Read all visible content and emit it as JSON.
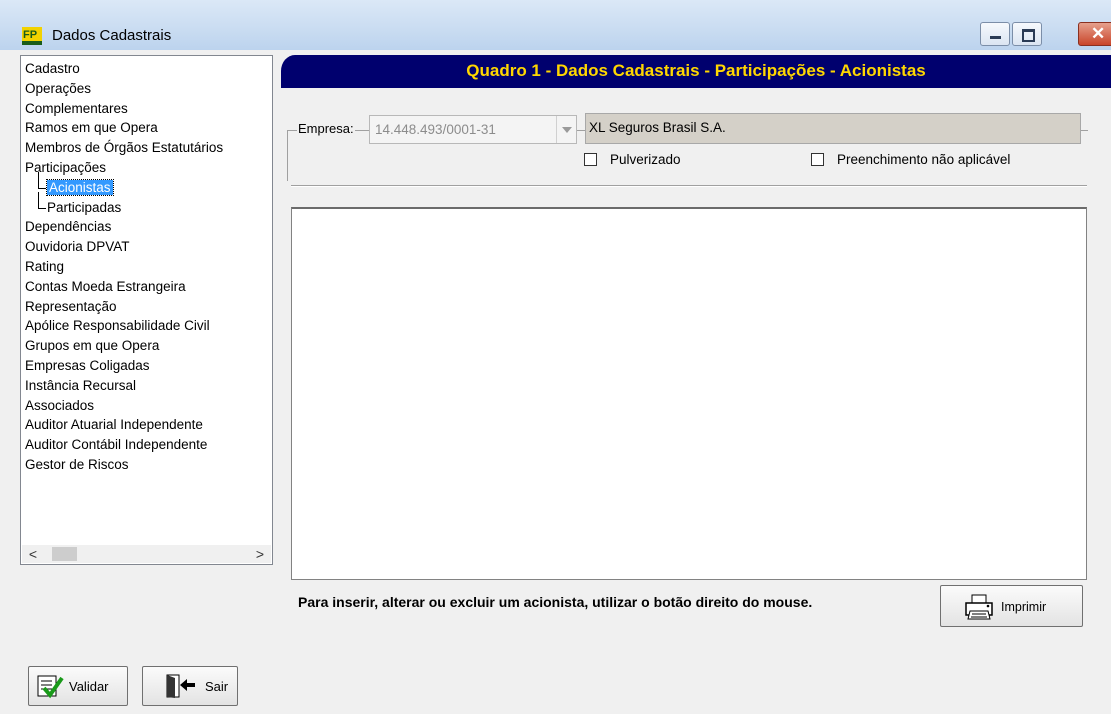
{
  "window": {
    "title": "Dados Cadastrais",
    "app_icon": "fip-logo-icon",
    "controls": [
      "minimize-icon",
      "maximize-icon",
      "close-icon"
    ]
  },
  "tree": {
    "items": [
      {
        "label": "Cadastro",
        "level": 0
      },
      {
        "label": "Operações",
        "level": 0
      },
      {
        "label": "Complementares",
        "level": 0
      },
      {
        "label": "Ramos em que Opera",
        "level": 0
      },
      {
        "label": "Membros de Órgãos Estatutários",
        "level": 0
      },
      {
        "label": "Participações",
        "level": 0
      },
      {
        "label": "Acionistas",
        "level": 1,
        "selected": true
      },
      {
        "label": "Participadas",
        "level": 1
      },
      {
        "label": "Dependências",
        "level": 0
      },
      {
        "label": "Ouvidoria DPVAT",
        "level": 0
      },
      {
        "label": "Rating",
        "level": 0
      },
      {
        "label": "Contas Moeda Estrangeira",
        "level": 0
      },
      {
        "label": "Representação",
        "level": 0
      },
      {
        "label": "Apólice Responsabilidade Civil",
        "level": 0
      },
      {
        "label": "Grupos em que Opera",
        "level": 0
      },
      {
        "label": "Empresas Coligadas",
        "level": 0
      },
      {
        "label": "Instância Recursal",
        "level": 0
      },
      {
        "label": "Associados",
        "level": 0
      },
      {
        "label": "Auditor Atuarial Independente",
        "level": 0
      },
      {
        "label": "Auditor Contábil Independente",
        "level": 0
      },
      {
        "label": "Gestor de Riscos",
        "level": 0
      }
    ]
  },
  "buttons": {
    "validar": "Validar",
    "sair": "Sair",
    "imprimir": "Imprimir"
  },
  "header": {
    "title": "Quadro 1 - Dados Cadastrais - Participações - Acionistas",
    "bg_color": "#00006e",
    "text_color": "#ffd700"
  },
  "form": {
    "empresa_label": "Empresa:",
    "empresa_cnpj": "14.448.493/0001-31",
    "empresa_nome": "XL Seguros Brasil S.A.",
    "pulverizado_label": "Pulverizado",
    "pulverizado_checked": false,
    "nao_aplicavel_label": "Preenchimento não aplicável",
    "nao_aplicavel_checked": false
  },
  "hint": "Para inserir, alterar ou excluir um acionista, utilizar o botão direito do mouse."
}
